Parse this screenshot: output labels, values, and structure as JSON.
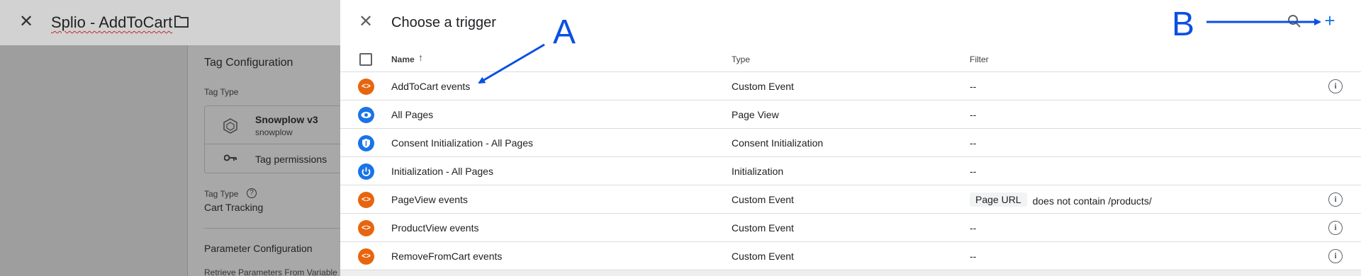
{
  "background_editor": {
    "title": "Splio - AddToCart",
    "section_title": "Tag Configuration",
    "tag_type_label": "Tag Type",
    "tag_name": "Snowplow v3",
    "tag_sub": "snowplow",
    "tag_permissions": "Tag permissions",
    "tag_type_label2": "Tag Type",
    "tag_type_value": "Cart Tracking",
    "param_config": "Parameter Configuration",
    "retrieve_label": "Retrieve Parameters From Variable"
  },
  "panel": {
    "title": "Choose a trigger",
    "columns": {
      "name": "Name",
      "type": "Type",
      "filter": "Filter"
    },
    "sort_arrow": "↑",
    "triggers": [
      {
        "name": "AddToCart events",
        "type": "Custom Event",
        "filter": "--",
        "icon": "custom-event-icon",
        "info": true
      },
      {
        "name": "All Pages",
        "type": "Page View",
        "filter": "--",
        "icon": "eye-icon",
        "info": false
      },
      {
        "name": "Consent Initialization - All Pages",
        "type": "Consent Initialization",
        "filter": "--",
        "icon": "shield-icon",
        "info": false
      },
      {
        "name": "Initialization - All Pages",
        "type": "Initialization",
        "filter": "--",
        "icon": "power-icon",
        "info": false
      },
      {
        "name": "PageView events",
        "type": "Custom Event",
        "filter_chip": "Page URL",
        "filter_text": "does not contain /products/",
        "icon": "custom-event-icon",
        "info": true
      },
      {
        "name": "ProductView events",
        "type": "Custom Event",
        "filter": "--",
        "icon": "custom-event-icon",
        "info": true
      },
      {
        "name": "RemoveFromCart events",
        "type": "Custom Event",
        "filter": "--",
        "icon": "custom-event-icon",
        "info": true
      }
    ]
  },
  "annotations": {
    "a": "A",
    "b": "B"
  },
  "colors": {
    "custom_event": "#e8650f",
    "blue": "#1a73e8",
    "annotation": "#0b4fe3"
  }
}
